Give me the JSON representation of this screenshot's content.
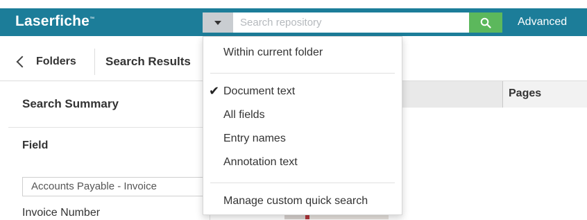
{
  "header": {
    "logo_text": "Laserfiche",
    "logo_mark": "™",
    "search_placeholder": "Search repository",
    "search_icon": "magnifier-icon",
    "advanced_label": "Advanced"
  },
  "nav": {
    "back_label": "Folders",
    "current_label": "Search Results"
  },
  "left_panel": {
    "summary_title": "Search Summary",
    "field_label": "Field",
    "template_value": "Accounts Payable - Invoice",
    "field_name": "Invoice Number"
  },
  "results": {
    "columns": [
      "Pages"
    ]
  },
  "dropdown": {
    "top_item": "Within current folder",
    "options": [
      {
        "label": "Document text",
        "checked": true
      },
      {
        "label": "All fields",
        "checked": false
      },
      {
        "label": "Entry names",
        "checked": false
      },
      {
        "label": "Annotation text",
        "checked": false
      }
    ],
    "check_glyph": "✔",
    "manage_label": "Manage custom quick search"
  },
  "colors": {
    "header_bg": "#1c7d99",
    "search_button": "#5cb85c",
    "toggle_bg": "#c9cdd1"
  }
}
